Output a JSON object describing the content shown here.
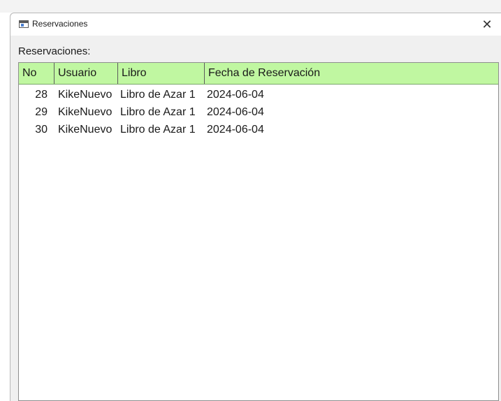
{
  "window": {
    "title": "Reservaciones",
    "close_glyph": "✕"
  },
  "main": {
    "section_label": "Reservaciones:"
  },
  "table": {
    "columns": [
      "No",
      "Usuario",
      "Libro",
      "Fecha de Reservación"
    ],
    "rows": [
      [
        "28",
        "KikeNuevo",
        "Libro de Azar 1",
        "2024-06-04"
      ],
      [
        "29",
        "KikeNuevo",
        "Libro de Azar 1",
        "2024-06-04"
      ],
      [
        "30",
        "KikeNuevo",
        "Libro de Azar 1",
        "2024-06-04"
      ]
    ],
    "header_color": "#c0f7a1"
  }
}
